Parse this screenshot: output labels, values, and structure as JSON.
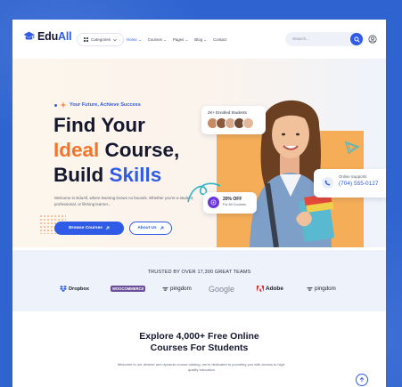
{
  "colors": {
    "background": "#2e63d0",
    "primary": "#2f5be7",
    "accent_orange": "#f2742a",
    "offer_purple": "#6b34e0",
    "hero_panel": "#f5ad57"
  },
  "header": {
    "logo": {
      "prefix": "Edu",
      "accent": "All",
      "icon": "graduation-cap-icon"
    },
    "categories_label": "Categories",
    "nav": [
      {
        "label": "Home",
        "has_dropdown": true,
        "active": true
      },
      {
        "label": "Courses",
        "has_dropdown": true,
        "active": false
      },
      {
        "label": "Pages",
        "has_dropdown": true,
        "active": false
      },
      {
        "label": "Blog",
        "has_dropdown": true,
        "active": false
      },
      {
        "label": "Contact",
        "has_dropdown": false,
        "active": false
      }
    ],
    "search_placeholder": "Search...",
    "search_icon": "search-icon",
    "user_icon": "user-icon"
  },
  "hero": {
    "subtitle": "Your Future, Achieve Success",
    "title_line1": "Find Your",
    "title_line2_accent": "Ideal",
    "title_line2_rest": " Course,",
    "title_line3_plain": "Build ",
    "title_line3_accent": "Skills",
    "description": "Welcome to EduAll, where learning knows no bounds. Whether you're a student, professional, or lifelong learner...",
    "primary_button": "Browse Courses",
    "secondary_button": "About Us",
    "students_card": {
      "label": "2K+ Enrolled Students"
    },
    "offer_card": {
      "title": "20% OFF",
      "subtitle": "For All Courses"
    },
    "support_card": {
      "title": "Online Supports",
      "phone": "(704) 555-0127"
    }
  },
  "trusted": {
    "title": "TRUSTED BY OVER 17,300 GREAT TEAMS",
    "brands": [
      "Dropbox",
      "WOOCOMMERCE",
      "pingdom",
      "Google",
      "Adobe",
      "pingdom"
    ]
  },
  "explore": {
    "title_line1": "Explore 4,000+ Free Online",
    "title_line2": "Courses For Students",
    "description": "Welcome to our diverse and dynamic course catalog. we're dedicated to providing you with access to high-quality education"
  }
}
